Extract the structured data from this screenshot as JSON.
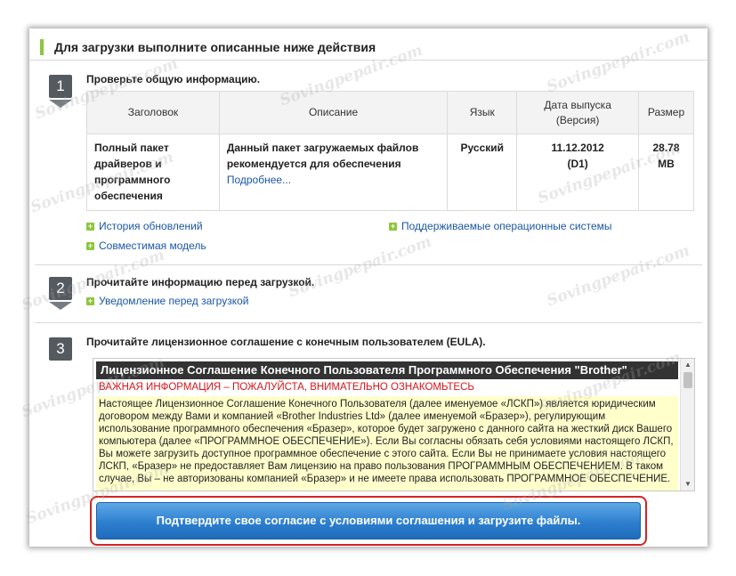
{
  "header": {
    "title": "Для загрузки выполните описанные ниже действия"
  },
  "steps": [
    {
      "number": "1",
      "title": "Проверьте общую информацию."
    },
    {
      "number": "2",
      "title": "Прочитайте информацию перед загрузкой."
    },
    {
      "number": "3",
      "title": "Прочитайте лицензионное соглашение с конечным пользователем (EULA)."
    }
  ],
  "table": {
    "headers": [
      "Заголовок",
      "Описание",
      "Язык",
      "Дата выпуска\n(Версия)",
      "Размер"
    ],
    "row": {
      "title": "Полный пакет драйверов и программного обеспечения",
      "description": "Данный пакет загружаемых файлов рекомендуется для обеспечения",
      "more_link": "Подробнее...",
      "language": "Русский",
      "date": "11.12.2012",
      "version": "(D1)",
      "size": "28.78 MB"
    }
  },
  "links": {
    "history": "История обновлений",
    "compatible": "Совместимая модель",
    "supported_os": "Поддерживаемые операционные системы",
    "notice": "Уведомление перед загрузкой"
  },
  "eula": {
    "heading": "Лицензионное Соглашение Конечного Пользователя Программного Обеспечения \"Brother\"",
    "warning": "ВАЖНАЯ ИНФОРМАЦИЯ – ПОЖАЛУЙСТА, ВНИМАТЕЛЬНО ОЗНАКОМЬТЕСЬ",
    "body": "Настоящее Лицензионное Соглашение Конечного Пользователя (далее именуемое «ЛСКП») является юридическим договором между Вами и компанией «Brother Industries Ltd» (далее именуемой «Бразер»), регулирующим использование программного обеспечения «Бразер», которое будет загружено с данного сайта на жесткий диск Вашего компьютера (далее «ПРОГРАММНОЕ ОБЕСПЕЧЕНИЕ»). Если Вы согласны обязать себя условиями настоящего ЛСКП, Вы можете загрузить доступное программное обеспечение с этого сайта. Если Вы не принимаете условия настоящего ЛСКП, «Бразер» не предоставляет Вам лицензию на право пользования ПРОГРАММНЫМ ОБЕСПЕЧЕНИЕМ. В таком случае, Вы – не авторизованы компанией «Бразер» и не имеете права использовать ПРОГРАММНОЕ ОБЕСПЕЧЕНИЕ."
  },
  "agree_button": "Подтвердите свое согласие с условиями соглашения и загрузите файлы.",
  "watermark": "Sovingpepair.com",
  "colors": {
    "accent_green": "#8cc63f",
    "link_blue": "#1a57a6",
    "warning_red": "#d8141a",
    "button_blue": "#2d7fcf",
    "highlight_red": "#d42424"
  }
}
